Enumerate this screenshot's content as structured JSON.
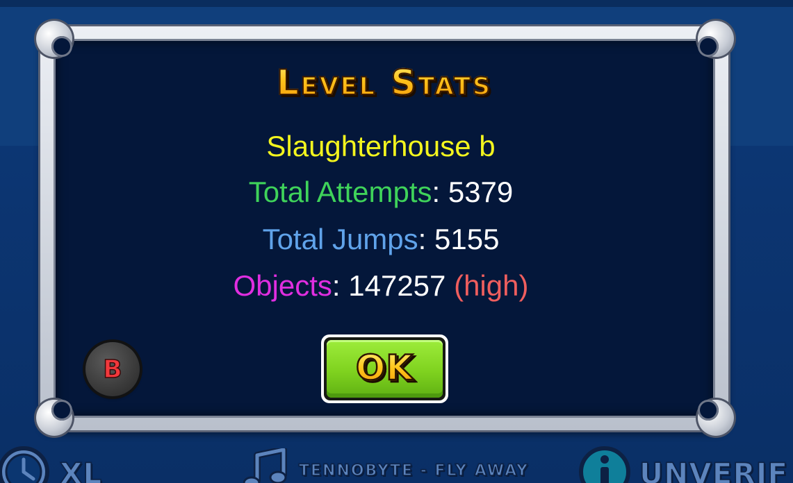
{
  "popup": {
    "title": "Level Stats",
    "level_name": "Slaughterhouse b",
    "attempts_label": "Total Attempts",
    "attempts_value": "5379",
    "jumps_label": "Total Jumps",
    "jumps_value": "5155",
    "objects_label": "Objects",
    "objects_value": "147257",
    "objects_rating": "(high)",
    "separator": ": ",
    "ok_label": "OK"
  },
  "badge": {
    "label": "B"
  },
  "hud": {
    "length": "XL",
    "song": "Tennobyte - Fly Away",
    "status": "Unverif"
  },
  "colors": {
    "level_name": "#f3f51e",
    "attempts_label": "#3fd35a",
    "jumps_label": "#60a3ea",
    "objects_label": "#e02ee0",
    "objects_rating": "#ef5e5e",
    "ok_button": "#7fd21f",
    "title_gold": "#ffc21a"
  },
  "icons": {
    "clock": "clock-icon",
    "music": "music-note-icon",
    "info": "info-icon"
  }
}
